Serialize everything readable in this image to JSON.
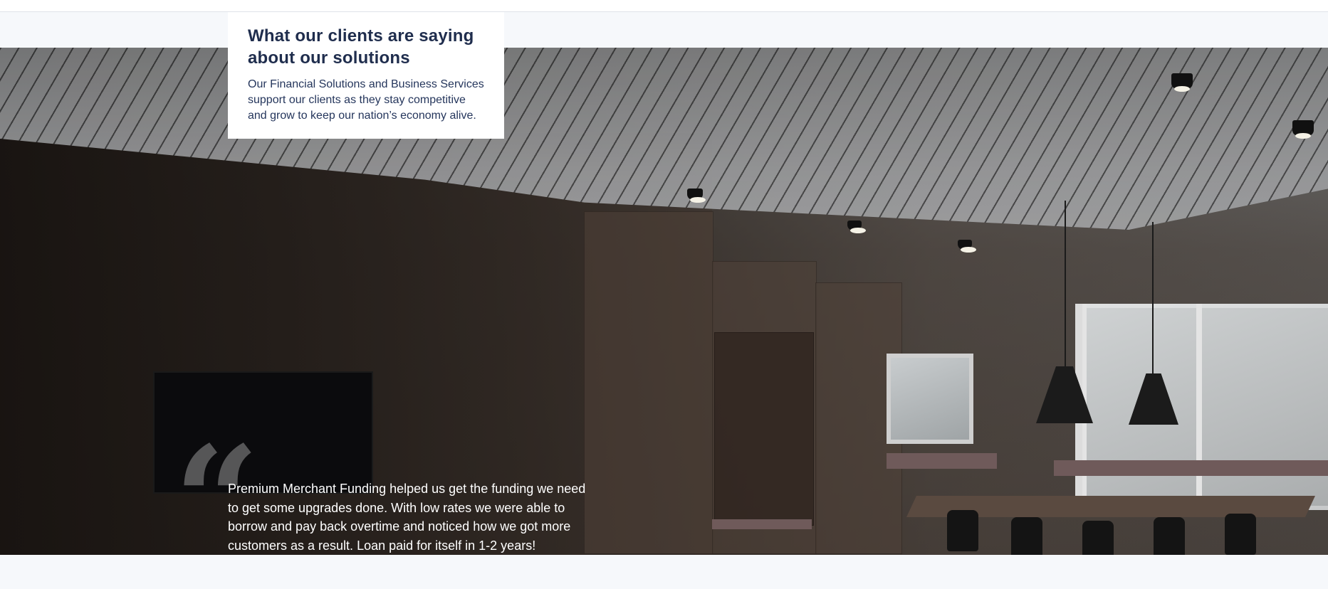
{
  "section": {
    "heading": "What our clients are saying about our solutions",
    "description": "Our Financial Solutions and Business Services support our clients as they stay competitive and grow to keep our nation’s economy alive."
  },
  "testimonial": {
    "quote_glyph": "“",
    "text": "Premium Merchant Funding helped us get the funding we need to get some upgrades done. With low rates we were able to borrow and pay back overtime and noticed how we got more customers as a result. Loan paid for itself in 1-2 years!"
  },
  "colors": {
    "heading": "#1f2d4d",
    "body_text": "#25365c",
    "page_background": "#f6f8fb",
    "quote_text": "#ffffff"
  }
}
